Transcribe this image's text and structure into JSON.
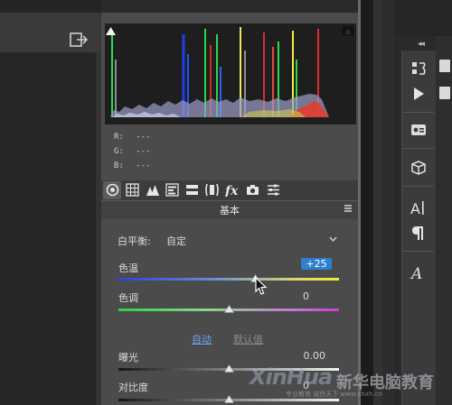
{
  "histogram": {
    "readout": [
      {
        "channel": "R:",
        "value": "---"
      },
      {
        "channel": "G:",
        "value": "---"
      },
      {
        "channel": "B:",
        "value": "---"
      }
    ]
  },
  "panel_tabs": [
    "basic-icon",
    "tone-curve-icon",
    "detail-icon",
    "hsl-icon",
    "split-toning-icon",
    "lens-corrections-icon",
    "fx-icon",
    "camera-calibration-icon",
    "presets-icon"
  ],
  "section": {
    "title": "基本"
  },
  "white_balance": {
    "label": "白平衡:",
    "value": "自定"
  },
  "params": {
    "temperature": {
      "label": "色温",
      "value": "+25",
      "level": 0.62
    },
    "tint": {
      "label": "色调",
      "value": "0",
      "level": 0.5
    },
    "auto_label": "自动",
    "default_label": "默认值",
    "exposure": {
      "label": "曝光",
      "value": "0.00",
      "level": 0.5
    },
    "contrast": {
      "label": "对比度",
      "value": "0",
      "level": 0.5
    }
  },
  "right_panel": {
    "collapse_label": "◂◂",
    "tools": [
      "history-icon",
      "play-icon",
      "image-info-icon",
      "3d-icon",
      "character-icon",
      "paragraph-icon",
      "glyphs-icon"
    ]
  },
  "watermark": {
    "logo": "XinHua",
    "name": "新华电脑教育",
    "sub": "专业教育·诚信天下 www.xhxh.cn"
  },
  "colors": {
    "panel_bg": "#4b4b4b",
    "accent_blue": "#2f7fd0",
    "link_blue": "#6ea6f2"
  }
}
